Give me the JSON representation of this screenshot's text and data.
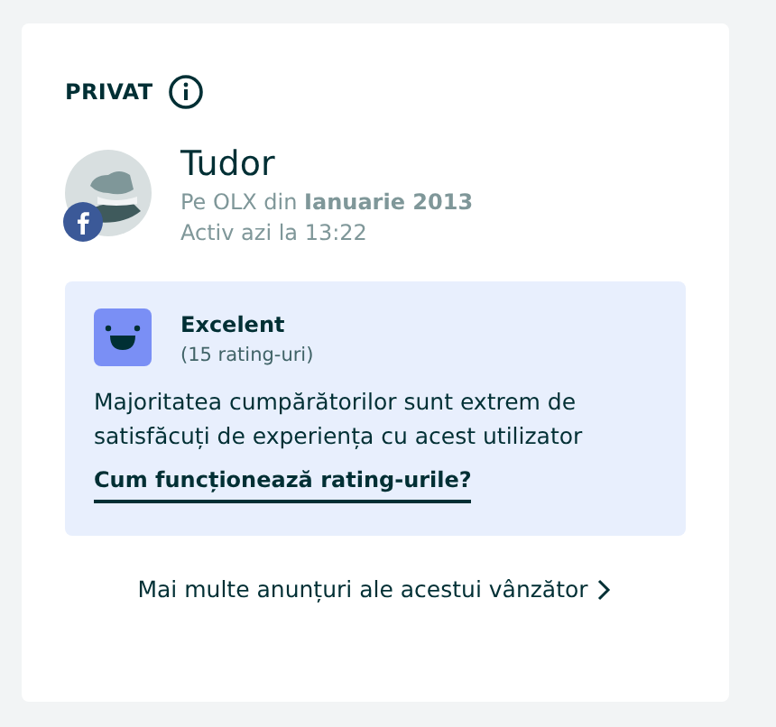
{
  "seller": {
    "type": "PRIVAT",
    "name": "Tudor",
    "member_since": "Pe OLX din **Ianuarie 2013**",
    "last_active": "Activ azi la 13:22",
    "facebook_verified": true
  },
  "rating": {
    "label": "Excelent",
    "count": "(15 rating-uri)",
    "description": "Majoritatea cumpărătorilor sunt extrem de satisfăcuți de experiența cu acest utilizator",
    "help_link": "Cum funcționează rating-urile?"
  },
  "more_ads_link": "Mai multe anunțuri ale acestui vânzător"
}
